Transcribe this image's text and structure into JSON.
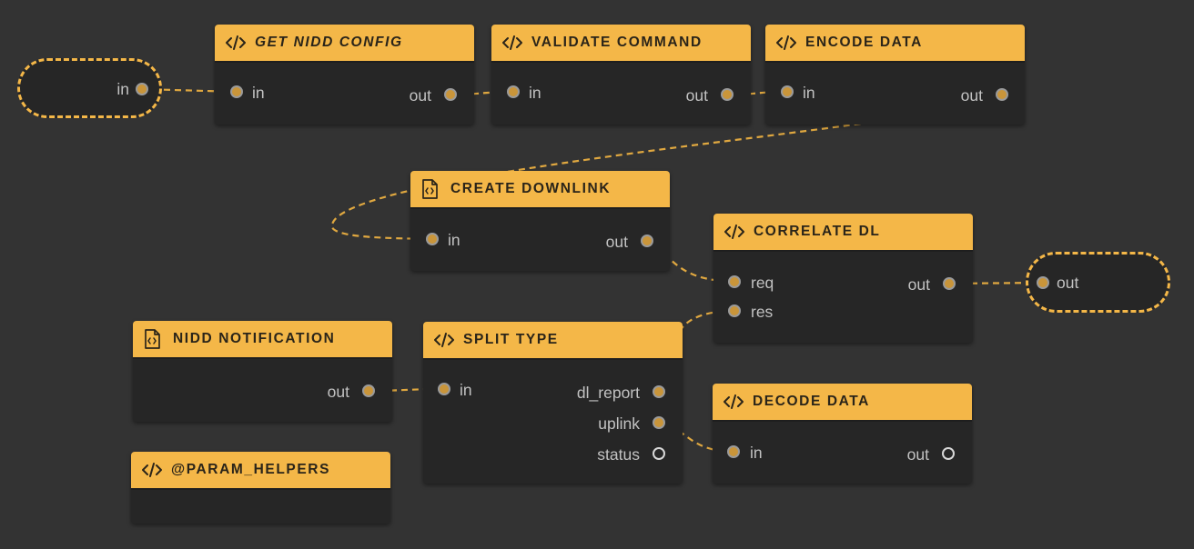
{
  "colors": {
    "background": "#333333",
    "node_body": "#262626",
    "header": "#f4b748",
    "wire": "#e0a840",
    "port_fill": "#c9953a"
  },
  "graph_input": {
    "label": "in"
  },
  "graph_output": {
    "label": "out"
  },
  "nodes": {
    "get_nidd_config": {
      "title": "GET NIDD CONFIG",
      "icon": "code-icon",
      "in": "in",
      "out": "out"
    },
    "validate_command": {
      "title": "VALIDATE COMMAND",
      "icon": "code-icon",
      "in": "in",
      "out": "out"
    },
    "encode_data": {
      "title": "ENCODE DATA",
      "icon": "code-icon",
      "in": "in",
      "out": "out"
    },
    "create_downlink": {
      "title": "CREATE DOWNLINK",
      "icon": "file-code-icon",
      "in": "in",
      "out": "out"
    },
    "correlate_dl": {
      "title": "CORRELATE DL",
      "icon": "code-icon",
      "req": "req",
      "res": "res",
      "out": "out"
    },
    "nidd_notification": {
      "title": "NIDD NOTIFICATION",
      "icon": "file-code-icon",
      "out": "out"
    },
    "split_type": {
      "title": "SPLIT TYPE",
      "icon": "code-icon",
      "in": "in",
      "dl_report": "dl_report",
      "uplink": "uplink",
      "status": "status"
    },
    "decode_data": {
      "title": "DECODE DATA",
      "icon": "code-icon",
      "in": "in",
      "out": "out"
    },
    "param_helpers": {
      "title": "@PARAM_HELPERS",
      "icon": "code-icon"
    }
  }
}
